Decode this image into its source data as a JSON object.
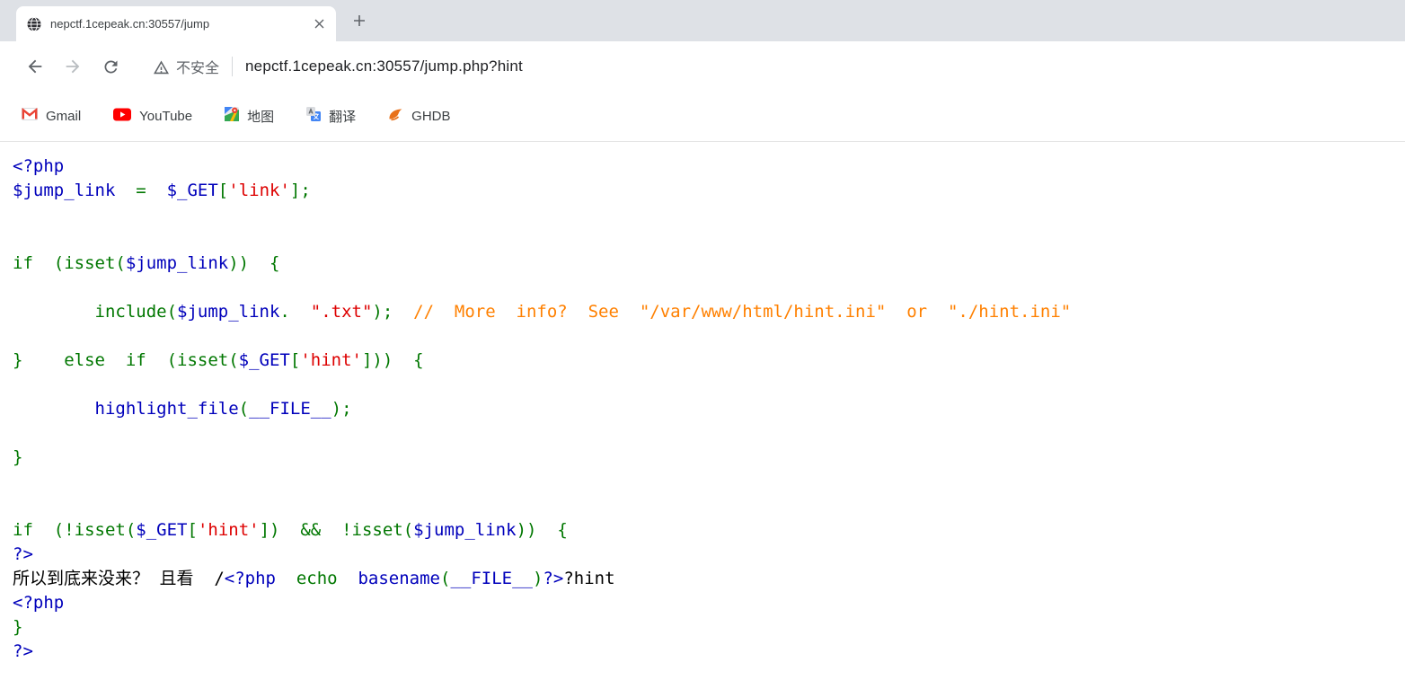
{
  "window": {
    "tab_title": "nepctf.1cepeak.cn:30557/jump"
  },
  "toolbar": {
    "security_label": "不安全",
    "url": "nepctf.1cepeak.cn:30557/jump.php?hint"
  },
  "bookmarks": [
    {
      "label": "Gmail"
    },
    {
      "label": "YouTube"
    },
    {
      "label": "地图"
    },
    {
      "label": "翻译"
    },
    {
      "label": "GHDB"
    }
  ],
  "code": {
    "colors": {
      "blue": "#0000BB",
      "green": "#007700",
      "red": "#DD0000",
      "orange": "#FF8000",
      "black": "#000000"
    },
    "lines": [
      [
        [
          "blue",
          "<?php"
        ]
      ],
      [
        [
          "blue",
          "$jump_link"
        ],
        [
          "green",
          "  =  "
        ],
        [
          "blue",
          "$_GET"
        ],
        [
          "green",
          "["
        ],
        [
          "red",
          "'link'"
        ],
        [
          "green",
          "];"
        ]
      ],
      [],
      [],
      [
        [
          "green",
          "if  (isset("
        ],
        [
          "blue",
          "$jump_link"
        ],
        [
          "green",
          "))  {"
        ]
      ],
      [],
      [
        [
          "green",
          "        include("
        ],
        [
          "blue",
          "$jump_link"
        ],
        [
          "green",
          ".  "
        ],
        [
          "red",
          "\".txt\""
        ],
        [
          "green",
          ");  "
        ],
        [
          "orange",
          "//  More  info?  See  \"/var/www/html/hint.ini\"  or  \"./hint.ini\""
        ]
      ],
      [],
      [
        [
          "green",
          "}    else  if  (isset("
        ],
        [
          "blue",
          "$_GET"
        ],
        [
          "green",
          "["
        ],
        [
          "red",
          "'hint'"
        ],
        [
          "green",
          "]))  {"
        ]
      ],
      [],
      [
        [
          "blue",
          "        highlight_file"
        ],
        [
          "green",
          "("
        ],
        [
          "blue",
          "__FILE__"
        ],
        [
          "green",
          ");"
        ]
      ],
      [],
      [
        [
          "green",
          "}"
        ]
      ],
      [],
      [],
      [
        [
          "green",
          "if  (!isset("
        ],
        [
          "blue",
          "$_GET"
        ],
        [
          "green",
          "["
        ],
        [
          "red",
          "'hint'"
        ],
        [
          "green",
          "])  &&  !isset("
        ],
        [
          "blue",
          "$jump_link"
        ],
        [
          "green",
          "))  {"
        ]
      ],
      [
        [
          "blue",
          "?>"
        ]
      ],
      [
        [
          "black",
          "所以到底来没来？ 且看  /"
        ],
        [
          "blue",
          "<?php"
        ],
        [
          "green",
          "  echo  "
        ],
        [
          "blue",
          "basename"
        ],
        [
          "green",
          "("
        ],
        [
          "blue",
          "__FILE__"
        ],
        [
          "green",
          ")"
        ],
        [
          "blue",
          "?>"
        ],
        [
          "black",
          "?hint"
        ]
      ],
      [
        [
          "blue",
          "<?php"
        ]
      ],
      [
        [
          "green",
          "}"
        ]
      ],
      [
        [
          "blue",
          "?>"
        ]
      ]
    ]
  }
}
